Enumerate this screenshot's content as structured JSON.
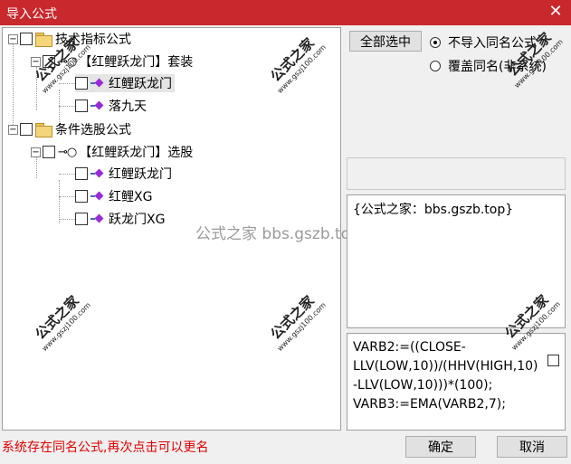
{
  "window": {
    "title": "导入公式",
    "close_glyph": "✕"
  },
  "tree": {
    "nodes": [
      {
        "label": "技术指标公式",
        "type": "folder",
        "toggle": "−"
      },
      {
        "label": "【红鲤跃龙门】套装",
        "type": "key",
        "toggle": "−"
      },
      {
        "label": "红鲤跃龙门",
        "type": "item"
      },
      {
        "label": "落九天",
        "type": "item"
      },
      {
        "label": "条件选股公式",
        "type": "folder",
        "toggle": "−"
      },
      {
        "label": "【红鲤跃龙门】选股",
        "type": "key",
        "toggle": "−"
      },
      {
        "label": "红鲤跃龙门",
        "type": "item"
      },
      {
        "label": "红鲤XG",
        "type": "item"
      },
      {
        "label": "跃龙门XG",
        "type": "item"
      }
    ],
    "key_glyph": "⊸○"
  },
  "buttons": {
    "select_all": "全部选中",
    "ok": "确定",
    "cancel": "取消"
  },
  "options": {
    "no_import": "不导入同名公式",
    "overwrite": "覆盖同名(非系统)",
    "selected": "no_import"
  },
  "description": "{公式之家：bbs.gszb.top}",
  "code": "VARB2:=((CLOSE-LLV(LOW,10))/(HHV(HIGH,10)-LLV(LOW,10)))*(100);\nVARB3:=EMA(VARB2,7);",
  "status_message": "系统存在同名公式,再次点击可以更名",
  "watermarks": {
    "center": "公式之家 bbs.gszb.top",
    "stamp_cn": "公式之家",
    "stamp_url": "www.gszj100.com"
  }
}
